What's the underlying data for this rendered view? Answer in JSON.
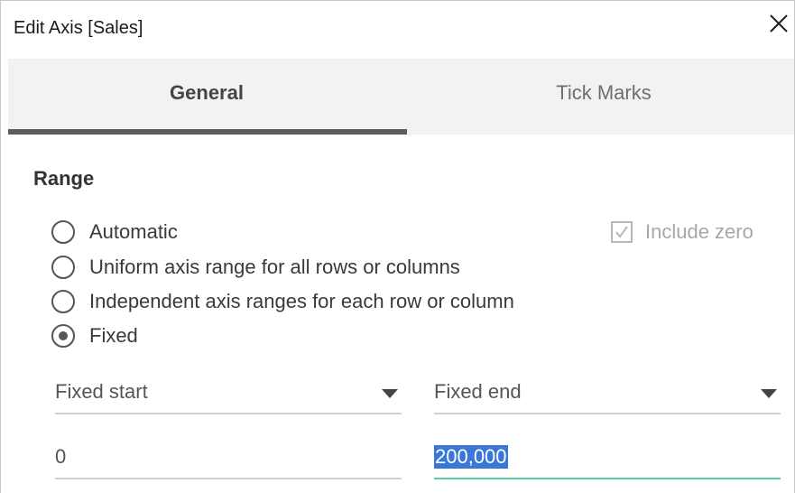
{
  "dialog": {
    "title": "Edit Axis [Sales]",
    "close_icon": "close-icon"
  },
  "tabs": [
    {
      "label": "General",
      "active": true
    },
    {
      "label": "Tick Marks",
      "active": false
    }
  ],
  "range": {
    "section_title": "Range",
    "options": [
      {
        "label": "Automatic",
        "checked": false
      },
      {
        "label": "Uniform axis range for all rows or columns",
        "checked": false
      },
      {
        "label": "Independent axis ranges for each row or column",
        "checked": false
      },
      {
        "label": "Fixed",
        "checked": true
      }
    ],
    "include_zero": {
      "label": "Include zero",
      "checked": true,
      "disabled": true
    }
  },
  "fixed": {
    "start_select": "Fixed start",
    "end_select": "Fixed end",
    "start_value": "0",
    "end_value": "200,000"
  },
  "colors": {
    "accent_underline": "#5cc9a8",
    "selection": "#3a78d8",
    "tab_indicator": "#5c5c5c"
  }
}
